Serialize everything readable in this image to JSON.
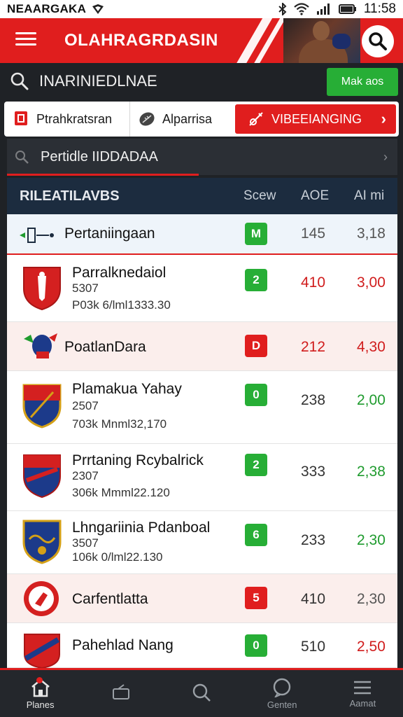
{
  "status_bar": {
    "carrier": "NEAARGAKA",
    "time": "11:58",
    "icons": [
      "shield-icon",
      "bluetooth-icon",
      "wifi-icon",
      "signal-icon",
      "battery-icon"
    ]
  },
  "header": {
    "title": "OLAHRAGRDASIN",
    "menu_icon": "hamburger-icon",
    "search_icon": "search-icon",
    "accent": "#e01e1e"
  },
  "search": {
    "value": "INARINIEDLNAE",
    "button_label": "Mak aos"
  },
  "tabs": [
    {
      "label": "Ptrahkratsran",
      "icon": "trophy-icon"
    },
    {
      "label": "Alparrisa",
      "icon": "ball-icon"
    },
    {
      "label": "VIBEEIANGING",
      "icon": "whistle-icon"
    }
  ],
  "sub_bar": {
    "label": "Pertidle IIDDADAA"
  },
  "table": {
    "title": "RILEATILAVBS",
    "columns": [
      "Scew",
      "AOE",
      "AI mi"
    ],
    "rows": [
      {
        "name": "Pertaniingaan",
        "sub1": "",
        "sub2": "",
        "badge": "M",
        "badge_color": "green",
        "c2": "145",
        "c3": "3,18",
        "c2_color": "grey",
        "c3_color": "grey"
      },
      {
        "name": "Parralknedaiol",
        "sub1": "5307",
        "sub2": "P03k 6/lml1333.30",
        "badge": "2",
        "badge_color": "green",
        "c2": "410",
        "c3": "3,00",
        "c2_color": "red",
        "c3_color": "red"
      },
      {
        "name": "PoatlanDara",
        "sub1": "",
        "sub2": "",
        "badge": "D",
        "badge_color": "red",
        "c2": "212",
        "c3": "4,30",
        "c2_color": "red",
        "c3_color": "red"
      },
      {
        "name": "Plamakua Yahay",
        "sub1": "2507",
        "sub2": "703k Mnml32,170",
        "badge": "0",
        "badge_color": "green",
        "c2": "238",
        "c3": "2,00",
        "c2_color": "grey",
        "c3_color": "green"
      },
      {
        "name": "Prrtaning Rcybalrick",
        "sub1": "2307",
        "sub2": "306k Mmml22.120",
        "badge": "2",
        "badge_color": "green",
        "c2": "333",
        "c3": "2,38",
        "c2_color": "grey",
        "c3_color": "green"
      },
      {
        "name": "Lhngariinia Pdanboal",
        "sub1": "3507",
        "sub2": "106k 0/lml22.130",
        "badge": "6",
        "badge_color": "green",
        "c2": "233",
        "c3": "2,30",
        "c2_color": "grey",
        "c3_color": "green"
      },
      {
        "name": "Carfentlatta",
        "sub1": "",
        "sub2": "",
        "badge": "5",
        "badge_color": "red",
        "c2": "410",
        "c3": "2,30",
        "c2_color": "grey",
        "c3_color": "grey"
      },
      {
        "name": "Pahehlad Nang",
        "sub1": "",
        "sub2": "",
        "badge": "0",
        "badge_color": "green",
        "c2": "510",
        "c3": "2,50",
        "c2_color": "grey",
        "c3_color": "red"
      }
    ]
  },
  "bottom_nav": [
    {
      "label": "Planes",
      "icon": "home-icon"
    },
    {
      "label": "",
      "icon": "inbox-icon"
    },
    {
      "label": "",
      "icon": "search-icon"
    },
    {
      "label": "Genten",
      "icon": "chat-icon"
    },
    {
      "label": "Aamat",
      "icon": "menu-icon"
    }
  ]
}
